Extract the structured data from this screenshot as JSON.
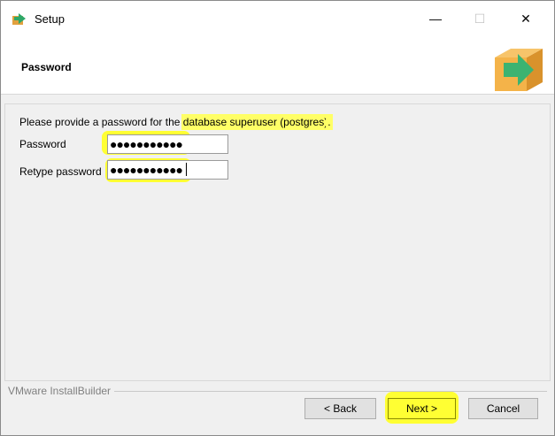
{
  "window": {
    "title": "Setup"
  },
  "titlebar": {
    "min_glyph": "—",
    "max_glyph": "☐",
    "close_glyph": "✕"
  },
  "header": {
    "title": "Password"
  },
  "content": {
    "intro_prefix": "Please provide a password for the ",
    "intro_highlight": "database superuser (postgres)",
    "intro_suffix": ".",
    "password_label": "Password",
    "password_value": "●●●●●●●●●●●",
    "retype_label": "Retype password",
    "retype_value": "●●●●●●●●●●●"
  },
  "footer": {
    "brand": "VMware InstallBuilder",
    "back_label": "< Back",
    "next_label": "Next >",
    "cancel_label": "Cancel"
  },
  "colors": {
    "highlight": "#ffff33",
    "box_orange": "#f4b349",
    "arrow_green": "#3cb371"
  }
}
